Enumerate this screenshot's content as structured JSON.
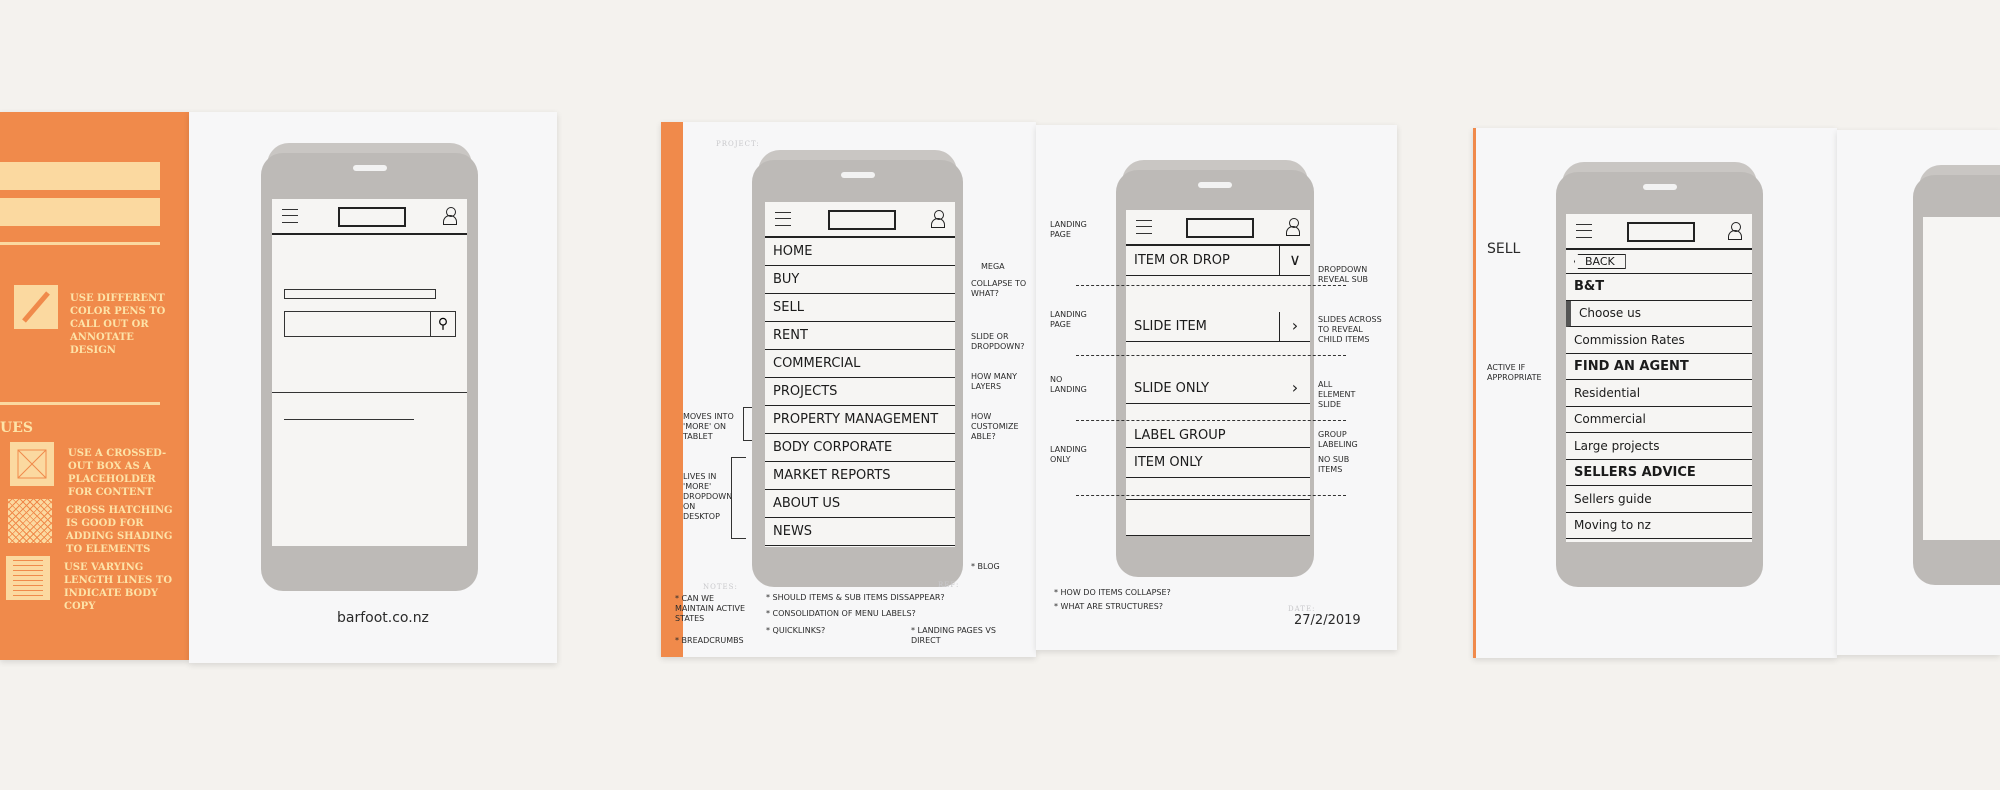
{
  "colors": {
    "orange": "#f08a4b",
    "cream": "#fbd9a0",
    "phone": "#bdbab7",
    "background": "#f4f2ee"
  },
  "book1": {
    "heading_partial": "UES",
    "tips": [
      {
        "icon": "pen-icon",
        "text": "USE DIFFERENT COLOR PENS TO CALL OUT OR ANNOTATE DESIGN"
      },
      {
        "icon": "crossed-box-icon",
        "text": "USE A CROSSED-OUT BOX AS A PLACEHOLDER FOR CONTENT"
      },
      {
        "icon": "cross-hatch-icon",
        "text": "CROSS HATCHING IS GOOD FOR ADDING SHADING TO ELEMENTS"
      },
      {
        "icon": "text-lines-icon",
        "text": "USE VARYING LENGTH LINES TO INDICATE BODY COPY"
      }
    ],
    "caption": "barfoot.co.nz"
  },
  "printed_labels": {
    "project": "PROJECT:",
    "notes": "NOTES:",
    "ref": "REF:",
    "date": "DATE:"
  },
  "book2_left": {
    "menu": [
      "HOME",
      "BUY",
      "SELL",
      "RENT",
      "COMMERCIAL",
      "PROJECTS",
      "PROPERTY MANAGEMENT",
      "BODY CORPORATE",
      "MARKET REPORTS",
      "ABOUT US",
      "NEWS"
    ],
    "annotations": {
      "mega": "MEGA",
      "collapse": "COLLAPSE TO WHAT?",
      "slide": "SLIDE OR DROPDOWN?",
      "layers": "HOW MANY LAYERS",
      "custom": "HOW CUSTOMIZE ABLE?",
      "tablet": "MOVES INTO 'MORE' ON TABLET",
      "desktop": "LIVES IN 'MORE' DROPDOWN ON DESKTOP",
      "blog": "* BLOG"
    },
    "notes": [
      "* CAN WE MAINTAIN ACTIVE STATES",
      "* BREADCRUMBS",
      "* SHOULD ITEMS & SUB ITEMS DISSAPPEAR?",
      "* CONSOLIDATION OF MENU LABELS?",
      "* QUICKLINKS?",
      "* LANDING PAGES VS DIRECT"
    ]
  },
  "book2_right": {
    "items": [
      "ITEM OR DROP",
      "SLIDE ITEM",
      "SLIDE ONLY",
      "LABEL GROUP",
      "ITEM ONLY"
    ],
    "left_annotations": [
      "LANDING PAGE",
      "LANDING PAGE",
      "NO LANDING",
      "LANDING ONLY"
    ],
    "right_annotations": [
      "DROPDOWN REVEAL SUB",
      "SLIDES ACROSS TO REVEAL CHILD ITEMS",
      "ALL ELEMENT SLIDE",
      "GROUP LABELING",
      "NO SUB ITEMS"
    ],
    "notes": [
      "* HOW DO ITEMS COLLAPSE?",
      "* WHAT ARE STRUCTURES?"
    ],
    "date": "27/2/2019"
  },
  "book3": {
    "sell_label": "SELL",
    "active_note": "ACTIVE IF APPROPRIATE",
    "back": "BACK",
    "rows": [
      {
        "label": "B&T",
        "heading": true
      },
      {
        "label": "Choose us",
        "heading": false,
        "active": true
      },
      {
        "label": "Commission Rates",
        "heading": false
      },
      {
        "label": "FIND AN AGENT",
        "heading": true
      },
      {
        "label": "Residential",
        "heading": false
      },
      {
        "label": "Commercial",
        "heading": false
      },
      {
        "label": "Large projects",
        "heading": false
      },
      {
        "label": "SELLERS ADVICE",
        "heading": true
      },
      {
        "label": "Sellers guide",
        "heading": false
      },
      {
        "label": "Moving to nz",
        "heading": false
      }
    ]
  }
}
